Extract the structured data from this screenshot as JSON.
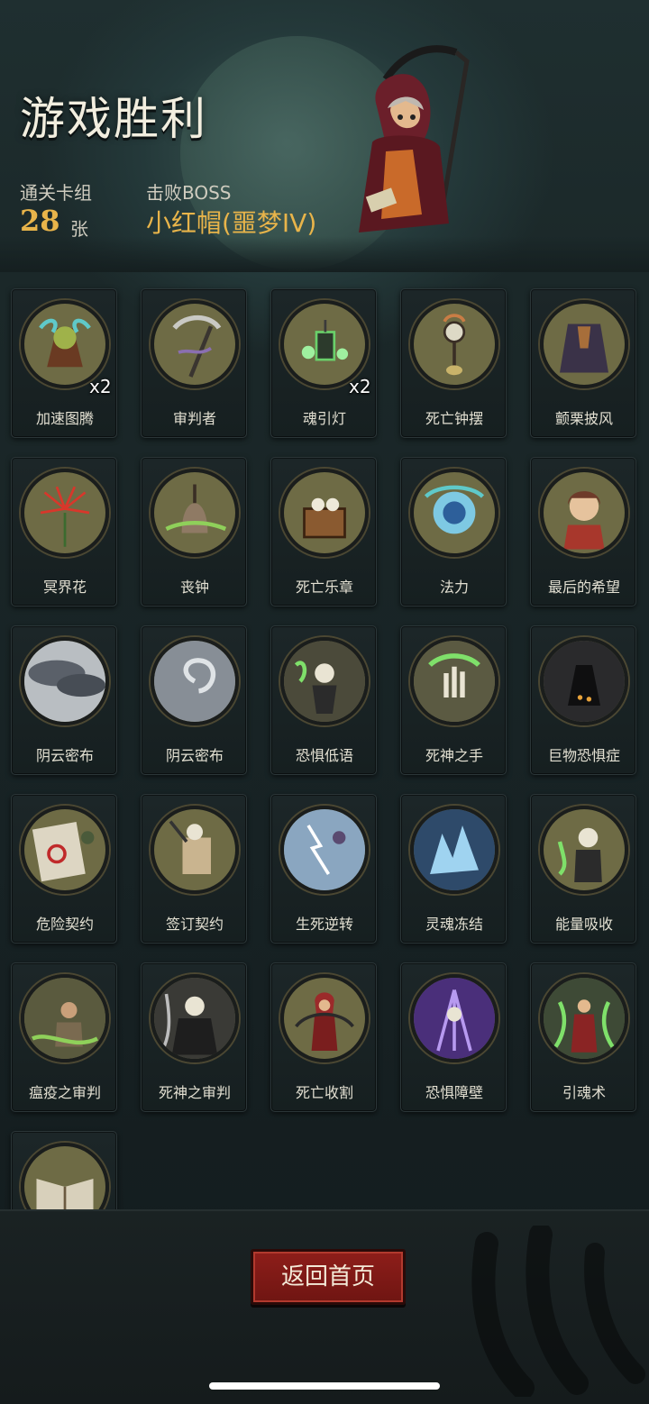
{
  "header": {
    "title": "游戏胜利",
    "cards_label": "通关卡组",
    "cards_count": "28",
    "cards_unit": "张",
    "boss_label": "击败BOSS",
    "boss_name": "小红帽(噩梦IV)"
  },
  "colors": {
    "accent_gold": "#e8b44a",
    "button_red": "#8e1e1a",
    "medal_bg": "#6e6b45"
  },
  "cards": [
    {
      "name": "加速图腾",
      "count": "x2",
      "icon": "totem-clock-icon"
    },
    {
      "name": "审判者",
      "count": "",
      "icon": "scythe-icon"
    },
    {
      "name": "魂引灯",
      "count": "x2",
      "icon": "lantern-icon"
    },
    {
      "name": "死亡钟摆",
      "count": "",
      "icon": "pendulum-clock-icon"
    },
    {
      "name": "颤栗披风",
      "count": "",
      "icon": "cloak-icon"
    },
    {
      "name": "冥界花",
      "count": "",
      "icon": "spider-lily-icon"
    },
    {
      "name": "丧钟",
      "count": "",
      "icon": "bell-icon"
    },
    {
      "name": "死亡乐章",
      "count": "",
      "icon": "music-box-skull-icon"
    },
    {
      "name": "法力",
      "count": "",
      "icon": "mana-orb-icon"
    },
    {
      "name": "最后的希望",
      "count": "",
      "icon": "girl-portrait-icon"
    },
    {
      "name": "阴云密布",
      "count": "",
      "icon": "storm-clouds-icon"
    },
    {
      "name": "阴云密布",
      "count": "",
      "icon": "storm-vortex-icon"
    },
    {
      "name": "恐惧低语",
      "count": "",
      "icon": "skeleton-whisper-icon"
    },
    {
      "name": "死神之手",
      "count": "",
      "icon": "skeletal-hand-icon"
    },
    {
      "name": "巨物恐惧症",
      "count": "",
      "icon": "giant-shadow-icon"
    },
    {
      "name": "危险契约",
      "count": "",
      "icon": "contract-seal-icon"
    },
    {
      "name": "签订契约",
      "count": "",
      "icon": "reaper-scroll-icon"
    },
    {
      "name": "生死逆转",
      "count": "",
      "icon": "lightning-reversal-icon"
    },
    {
      "name": "灵魂冻结",
      "count": "",
      "icon": "ice-crystal-icon"
    },
    {
      "name": "能量吸收",
      "count": "",
      "icon": "reaper-drain-icon"
    },
    {
      "name": "瘟疫之审判",
      "count": "",
      "icon": "plague-victim-icon"
    },
    {
      "name": "死神之审判",
      "count": "",
      "icon": "reaper-judgment-icon"
    },
    {
      "name": "死亡收割",
      "count": "",
      "icon": "red-hood-harvest-icon"
    },
    {
      "name": "恐惧障壁",
      "count": "",
      "icon": "purple-barrier-icon"
    },
    {
      "name": "引魂术",
      "count": "",
      "icon": "soul-summon-icon"
    },
    {
      "name": "",
      "count": "",
      "icon": "open-book-icon"
    }
  ],
  "footer": {
    "home_button": "返回首页"
  }
}
